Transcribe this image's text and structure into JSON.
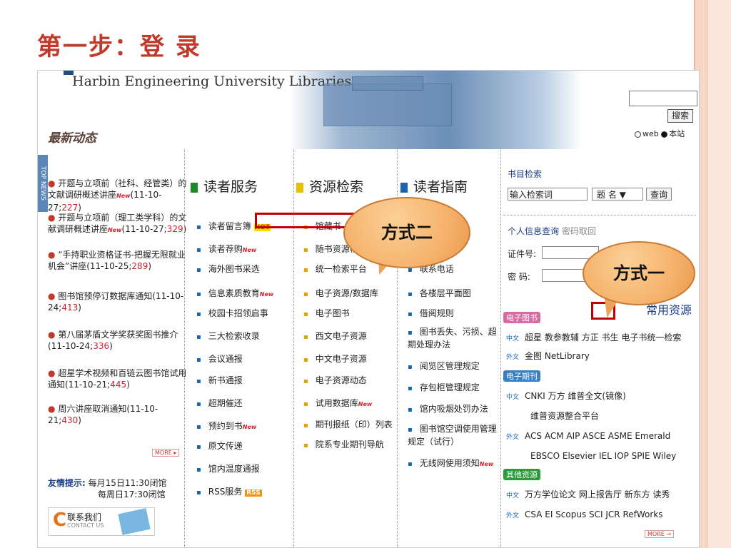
{
  "slide_title": "第一步：登 录",
  "site": {
    "library_name": "Harbin Engineering University Libraries",
    "latest_news_title": "最新动态",
    "search_button": "搜索",
    "scope_web": "web",
    "scope_local": "本站",
    "top_news_label": "TOP NEWS"
  },
  "news": [
    {
      "text": "开题与立项前（社科、经管类）的文献调研概述讲座",
      "date_prefix": "(11-10-27;",
      "count": "227",
      "date_suffix": ")"
    },
    {
      "text": "开题与立项前（理工类学科）的文献调研概述讲座",
      "date_prefix": "(11-10-27;",
      "count": "329",
      "date_suffix": ")"
    },
    {
      "text": "“手持职业资格证书-把握无限就业机会”讲座",
      "date_prefix": "(11-10-25;",
      "count": "289",
      "date_suffix": ")"
    },
    {
      "text": "图书馆预停订数据库通知",
      "date_prefix": "(11-10-24;",
      "count": "413",
      "date_suffix": ")"
    },
    {
      "text": "第八届茅盾文学奖获奖图书推介",
      "date_prefix": "(11-10-24;",
      "count": "336",
      "date_suffix": ")"
    },
    {
      "text": "超星学术视频和百链云图书馆试用通知",
      "date_prefix": "(11-10-21;",
      "count": "445",
      "date_suffix": ")"
    },
    {
      "text": "周六讲座取消通知",
      "date_prefix": "(11-10-21;",
      "count": "430",
      "date_suffix": ")"
    }
  ],
  "more_left": "MORE ▸",
  "friendly": {
    "label": "友情提示:",
    "line1": "每月15日11:30闭馆",
    "line2": "每周日17:30闭馆",
    "contact": "联系我们",
    "contact_en": "CONTACT US"
  },
  "columns": {
    "reader_service": {
      "title": "读者服务",
      "items": [
        "读者留言簿",
        "读者荐购",
        "海外图书采选",
        "信息素质教育",
        "校园卡招领启事",
        "三大检索收录",
        "会议通报",
        "新书通报",
        "超期催还",
        "预约到书",
        "原文传递",
        "馆内温度通报",
        "RSS服务"
      ],
      "hot": "HOT",
      "new": "New",
      "rss": "RSS"
    },
    "resource_search": {
      "title": "资源检索",
      "items": [
        "馆藏书",
        "随书资源检",
        "统一检索平台",
        "电子资源/数据库",
        "电子图书",
        "西文电子资源",
        "中文电子资源",
        "电子资源动态",
        "试用数据库",
        "期刊报纸（印）列表",
        "院系专业期刊导航"
      ]
    },
    "reader_guide": {
      "title": "读者指南",
      "items": [
        "联系电话",
        "各楼层平面图",
        "借阅规则",
        "图书丢失、污损、超期处理办法",
        "阅览区管理规定",
        "存包柜管理规定",
        "馆内吸烟处罚办法",
        "图书馆空调使用管理规定（试行）",
        "无线网使用须知"
      ]
    }
  },
  "right": {
    "catalog_label": "书目检索",
    "catalog_input": "输入检索词",
    "catalog_field": "题 名",
    "catalog_query": "查询",
    "personal_label": "个人信息查询",
    "password_recover": "密码取回",
    "id_label": "证件号:",
    "pwd_label": "密 码:",
    "common_resources": "常用资源",
    "ebook_tag": "电子图书",
    "ebook_cn": [
      "超星",
      "教参教辅",
      "方正",
      "书生",
      "电子书统一检索"
    ],
    "ebook_en": [
      "金图",
      "NetLibrary"
    ],
    "ejournal_tag": "电子期刊",
    "ejournal_cn_1": "CNKI 万方 维普全文(镜像)",
    "ejournal_cn_2": "维普资源整合平台",
    "ejournal_en_1": "ACS ACM AIP ASCE ASME Emerald",
    "ejournal_en_2": "EBSCO Elsevier IEL IOP SPIE Wiley",
    "other_tag": "其他资源",
    "other_cn": "万方学位论文 网上报告厅 新东方 读秀",
    "other_en": "CSA EI Scopus SCI JCR RefWorks",
    "more": "MORE →",
    "lang_cn": "中文",
    "lang_en": "外文"
  },
  "callouts": {
    "method_two": "方式二",
    "method_one": "方式一"
  },
  "colors": {
    "title_red": "#c0392b",
    "highlight_red": "#c00000",
    "bubble": "#f5b26b"
  }
}
